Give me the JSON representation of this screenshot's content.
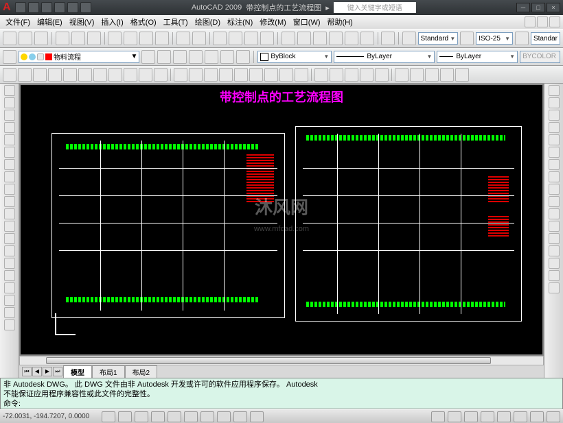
{
  "app": {
    "name": "AutoCAD 2009",
    "file": "带控制点的工艺流程图",
    "search_placeholder": "键入关键字或短语"
  },
  "menu": [
    "文件(F)",
    "编辑(E)",
    "视图(V)",
    "插入(I)",
    "格式(O)",
    "工具(T)",
    "绘图(D)",
    "标注(N)",
    "修改(M)",
    "窗口(W)",
    "帮助(H)"
  ],
  "styles": {
    "text_style": "Standard",
    "dim_style": "ISO-25",
    "table_style": "Standar"
  },
  "layers": {
    "current": "物料流程"
  },
  "props": {
    "color": "ByBlock",
    "linetype": "ByLayer",
    "lineweight": "ByLayer",
    "plotstyle": "BYCOLOR"
  },
  "drawing": {
    "title": "带控制点的工艺流程图"
  },
  "tabs": {
    "model": "模型",
    "layout1": "布局1",
    "layout2": "布局2"
  },
  "cmd": {
    "line1": "非 Autodesk DWG。  此 DWG 文件由非 Autodesk 开发或许可的软件应用程序保存。  Autodesk",
    "line2": "不能保证应用程序兼容性或此文件的完整性。",
    "prompt": "命令:"
  },
  "status": {
    "coords": "-72.0031, -194.7207, 0.0000"
  },
  "watermark": {
    "text": "沐风网",
    "url": "www.mfcad.com"
  }
}
